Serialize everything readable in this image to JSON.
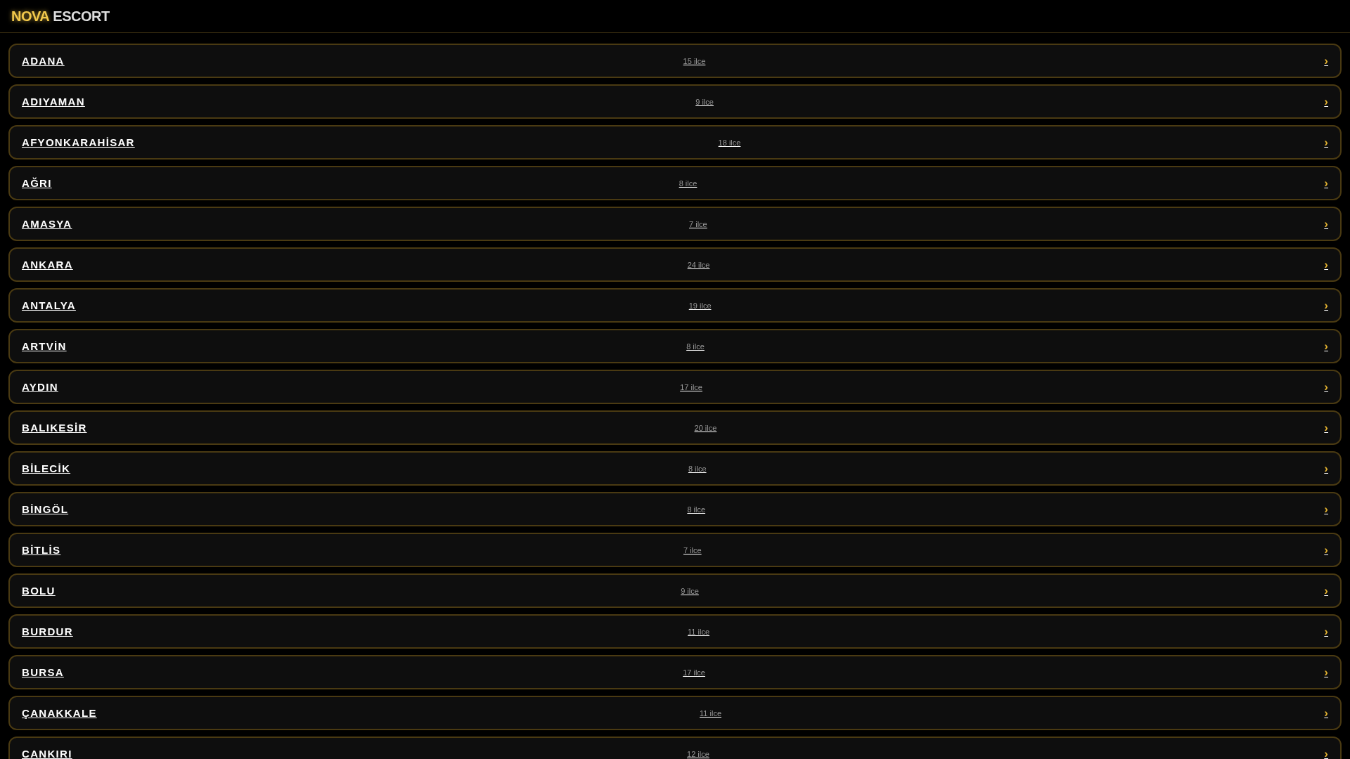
{
  "header": {
    "logo_accent": "NOVA",
    "logo_rest": "ESCORT"
  },
  "cities": [
    {
      "name": "ADANA",
      "count": "15 ilce",
      "chevron": "›"
    },
    {
      "name": "ADIYAMAN",
      "count": "9 ilce",
      "chevron": "›"
    },
    {
      "name": "AFYONKARAHİSAR",
      "count": "18 ilce",
      "chevron": "›"
    },
    {
      "name": "AĞRI",
      "count": "8 ilce",
      "chevron": "›"
    },
    {
      "name": "AMASYA",
      "count": "7 ilce",
      "chevron": "›"
    },
    {
      "name": "ANKARA",
      "count": "24 ilce",
      "chevron": "›"
    },
    {
      "name": "ANTALYA",
      "count": "19 ilce",
      "chevron": "›"
    },
    {
      "name": "ARTVİN",
      "count": "8 ilce",
      "chevron": "›"
    },
    {
      "name": "AYDIN",
      "count": "17 ilce",
      "chevron": "›"
    },
    {
      "name": "BALIKESİR",
      "count": "20 ilce",
      "chevron": "›"
    },
    {
      "name": "BİLECİK",
      "count": "8 ilce",
      "chevron": "›"
    },
    {
      "name": "BİNGÖL",
      "count": "8 ilce",
      "chevron": "›"
    },
    {
      "name": "BİTLİS",
      "count": "7 ilce",
      "chevron": "›"
    },
    {
      "name": "BOLU",
      "count": "9 ilce",
      "chevron": "›"
    },
    {
      "name": "BURDUR",
      "count": "11 ilce",
      "chevron": "›"
    },
    {
      "name": "BURSA",
      "count": "17 ilce",
      "chevron": "›"
    },
    {
      "name": "ÇANAKKALE",
      "count": "11 ilce",
      "chevron": "›"
    },
    {
      "name": "CANKIRI",
      "count": "12 ilce",
      "chevron": "›"
    }
  ]
}
